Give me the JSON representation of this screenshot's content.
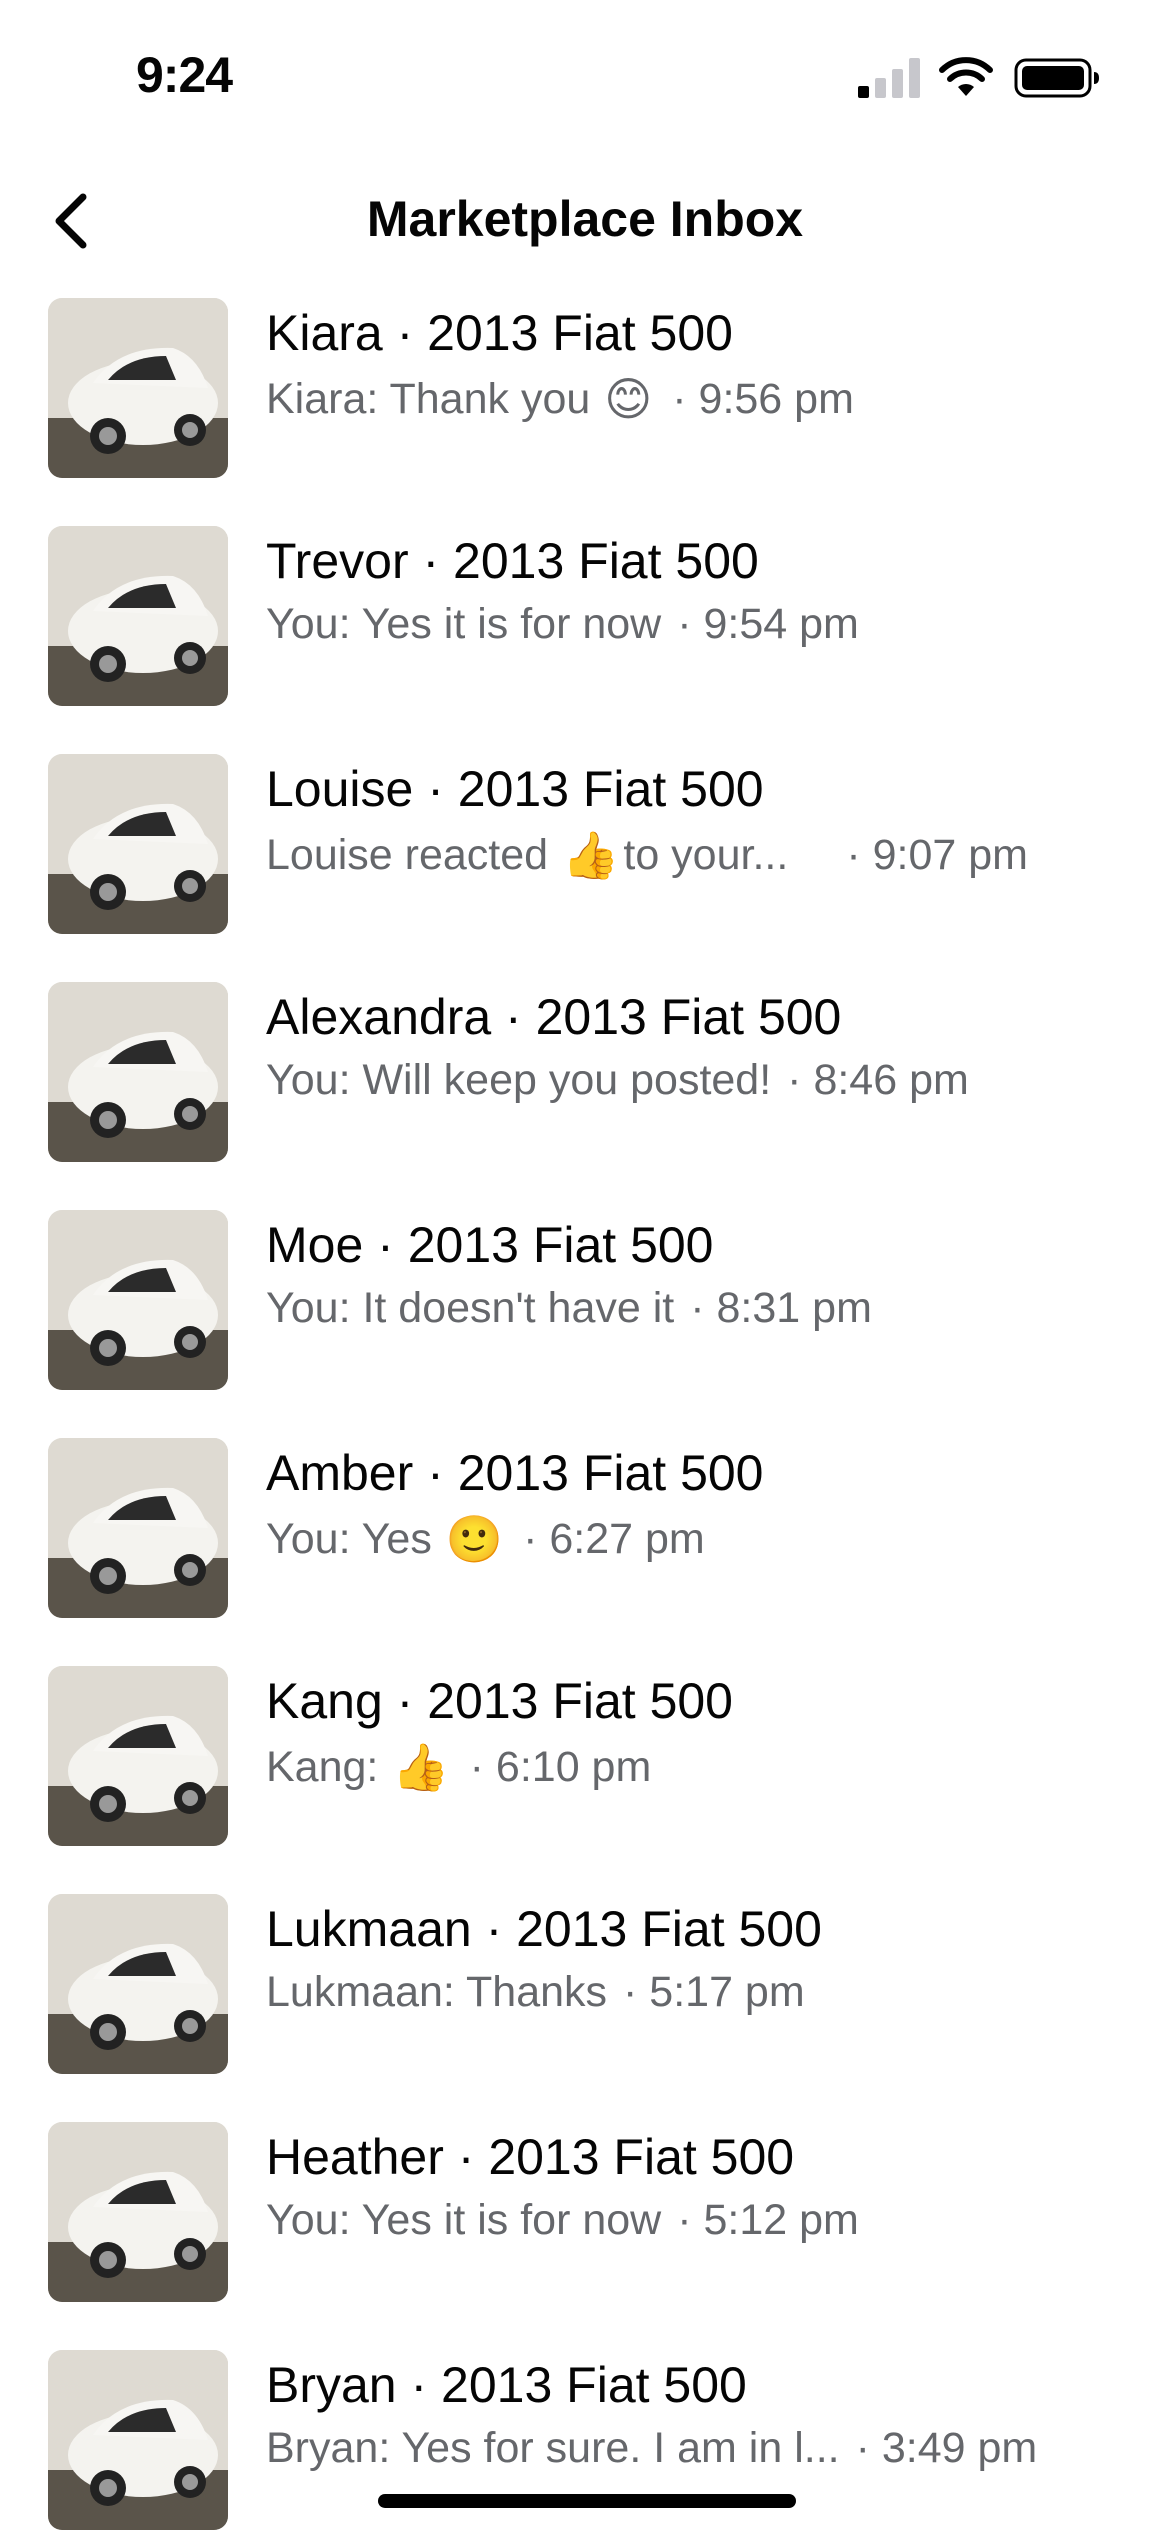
{
  "status_bar": {
    "time": "9:24"
  },
  "nav": {
    "title": "Marketplace Inbox"
  },
  "conversations": [
    {
      "title": "Kiara · 2013 Fiat 500",
      "preview": "Kiara: Thank you",
      "emoji": "😊",
      "time": "· 9:56 pm"
    },
    {
      "title": "Trevor · 2013 Fiat 500",
      "preview": "You: Yes it is for now",
      "emoji": "",
      "time": "· 9:54 pm"
    },
    {
      "title": "Louise · 2013 Fiat 500",
      "preview": "Louise reacted",
      "emoji": "👍",
      "preview_suffix": "to your...",
      "time": "· 9:07 pm"
    },
    {
      "title": "Alexandra · 2013 Fiat 500",
      "preview": "You: Will keep you posted!",
      "emoji": "",
      "time": "· 8:46 pm"
    },
    {
      "title": "Moe · 2013 Fiat 500",
      "preview": "You: It doesn't have it",
      "emoji": "",
      "time": "· 8:31 pm"
    },
    {
      "title": "Amber · 2013 Fiat 500",
      "preview": "You: Yes",
      "emoji": "🙂",
      "time": "· 6:27 pm"
    },
    {
      "title": "Kang · 2013 Fiat 500",
      "preview": "Kang:",
      "emoji": "👍",
      "time": "· 6:10 pm"
    },
    {
      "title": "Lukmaan · 2013 Fiat 500",
      "preview": "Lukmaan: Thanks",
      "emoji": "",
      "time": "· 5:17 pm"
    },
    {
      "title": "Heather · 2013 Fiat 500",
      "preview": "You: Yes it is for now",
      "emoji": "",
      "time": "· 5:12 pm"
    },
    {
      "title": "Bryan · 2013 Fiat 500",
      "preview": "Bryan: Yes for sure. I am in l...",
      "emoji": "",
      "time": "· 3:49 pm"
    }
  ]
}
